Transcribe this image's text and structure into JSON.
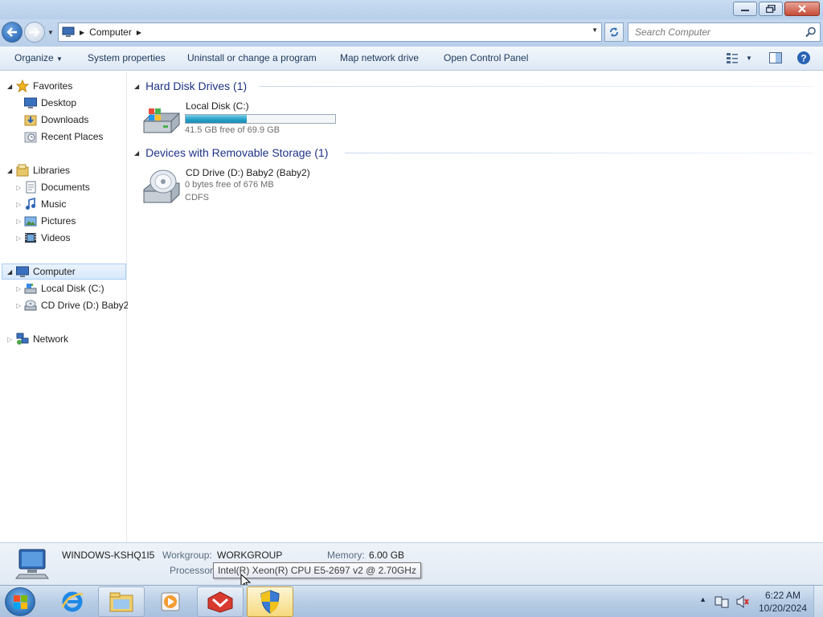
{
  "window": {
    "minimize_icon": "minimize-icon",
    "maximize_icon": "restore-icon",
    "close_icon": "close-icon"
  },
  "address": {
    "crumbs": [
      "Computer"
    ],
    "search_placeholder": "Search Computer"
  },
  "commandbar": {
    "organize": "Organize",
    "system_properties": "System properties",
    "uninstall": "Uninstall or change a program",
    "map_drive": "Map network drive",
    "control_panel": "Open Control Panel"
  },
  "navpane": {
    "favorites": "Favorites",
    "desktop": "Desktop",
    "downloads": "Downloads",
    "recent": "Recent Places",
    "libraries": "Libraries",
    "documents": "Documents",
    "music": "Music",
    "pictures": "Pictures",
    "videos": "Videos",
    "computer": "Computer",
    "local_disk": "Local Disk (C:)",
    "cd_drive": "CD Drive (D:) Baby2",
    "network": "Network"
  },
  "content": {
    "hdd_group": "Hard Disk Drives (1)",
    "removable_group": "Devices with Removable Storage (1)",
    "local_disk": {
      "name": "Local Disk (C:)",
      "free_text": "41.5 GB free of 69.9 GB",
      "used_fraction": 0.406
    },
    "cd_drive": {
      "name": "CD Drive (D:) Baby2 (Baby2)",
      "free_text": "0 bytes free of 676 MB",
      "filesystem": "CDFS"
    }
  },
  "details": {
    "computer_name": "WINDOWS-KSHQ1I5",
    "workgroup_label": "Workgroup:",
    "workgroup": "WORKGROUP",
    "memory_label": "Memory:",
    "memory": "6.00 GB",
    "processor_label": "Processor:",
    "processor": "Intel(R) Xeon(R) CPU E5-2697 v2 @ 2.70GHz"
  },
  "taskbar": {
    "time": "6:22 AM",
    "date": "10/20/2024"
  },
  "colors": {
    "group_header": "#1e3287",
    "capacity_fill": "#26a0c9",
    "selection": "#d9e9fb"
  }
}
